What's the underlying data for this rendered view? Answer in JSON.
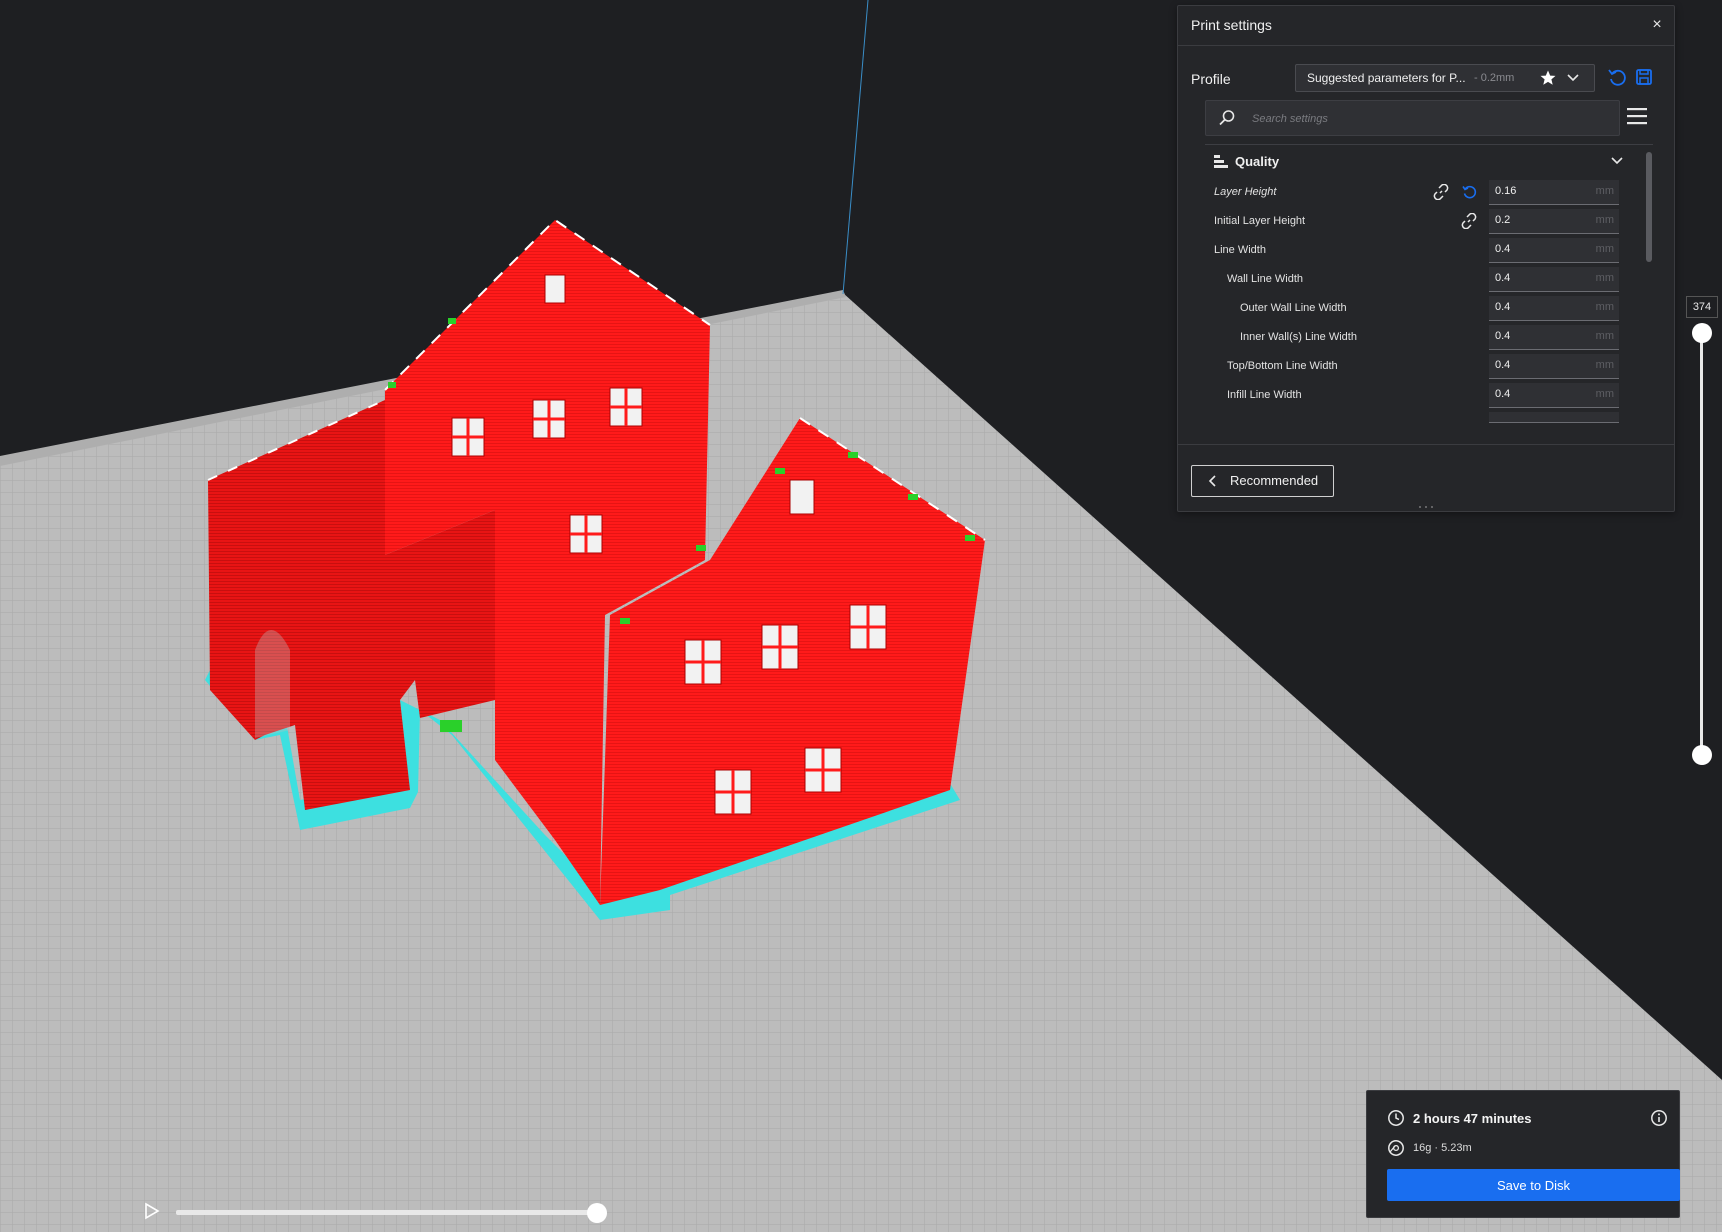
{
  "print_settings": {
    "title": "Print settings",
    "close_icon": "×",
    "profile": {
      "label": "Profile",
      "name": "Suggested parameters for P...",
      "suffix": "- 0.2mm"
    },
    "search": {
      "placeholder": "Search settings"
    },
    "category": {
      "label": "Quality"
    },
    "settings": [
      {
        "label": "Layer Height",
        "value": "0.16",
        "unit": "mm"
      },
      {
        "label": "Initial Layer Height",
        "value": "0.2",
        "unit": "mm"
      },
      {
        "label": "Line Width",
        "value": "0.4",
        "unit": "mm"
      },
      {
        "label": "Wall Line Width",
        "value": "0.4",
        "unit": "mm"
      },
      {
        "label": "Outer Wall Line Width",
        "value": "0.4",
        "unit": "mm"
      },
      {
        "label": "Inner Wall(s) Line Width",
        "value": "0.4",
        "unit": "mm"
      },
      {
        "label": "Top/Bottom Line Width",
        "value": "0.4",
        "unit": "mm"
      },
      {
        "label": "Infill Line Width",
        "value": "0.4",
        "unit": "mm"
      }
    ],
    "recommended_label": "Recommended"
  },
  "layer_slider": {
    "value": "374"
  },
  "print_info": {
    "time": "2 hours 47 minutes",
    "material": "16g · 5.23m",
    "save_label": "Save to Disk"
  },
  "playback": {
    "progress": 1.0
  },
  "colors": {
    "accent": "#196ef0",
    "model_walls": "#ff1a1a",
    "skirt": "#3de0e0",
    "support": "#2ad02a",
    "build_plate": "#bdbdbd"
  }
}
